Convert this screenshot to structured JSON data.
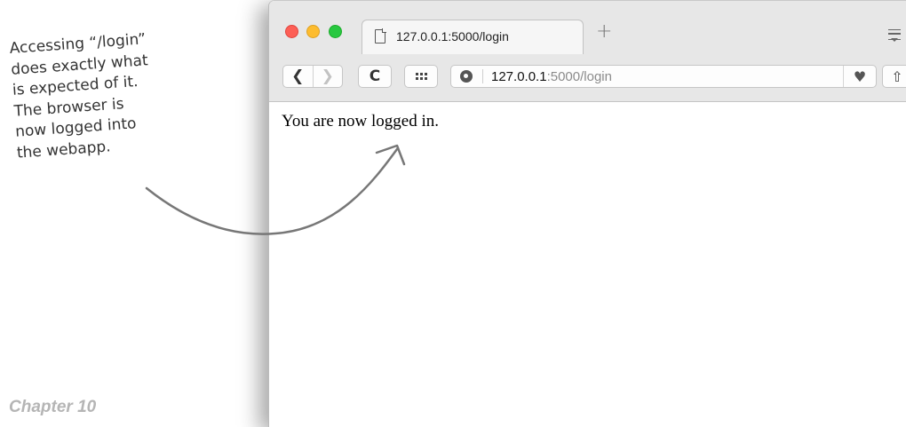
{
  "annotation": {
    "lines": [
      "Accessing “/login”",
      "does exactly what",
      "is expected of it.",
      "The browser is",
      "now logged into",
      "the webapp."
    ]
  },
  "footer": {
    "chapter": "Chapter 10"
  },
  "browser": {
    "tab_title": "127.0.0.1:5000/login",
    "new_tab_symbol": "+",
    "address": {
      "host": "127.0.0.1",
      "rest": ":5000/login"
    },
    "back_symbol": "❮",
    "forward_symbol": "❯",
    "reload_symbol": "C",
    "favorite_symbol": "♥",
    "share_symbol": "⇧"
  },
  "page": {
    "message": "You are now logged in."
  },
  "colors": {
    "close": "#fd5f56",
    "minimize": "#fdbc2e",
    "zoom": "#28c840",
    "chrome": "#e7e7e7"
  }
}
